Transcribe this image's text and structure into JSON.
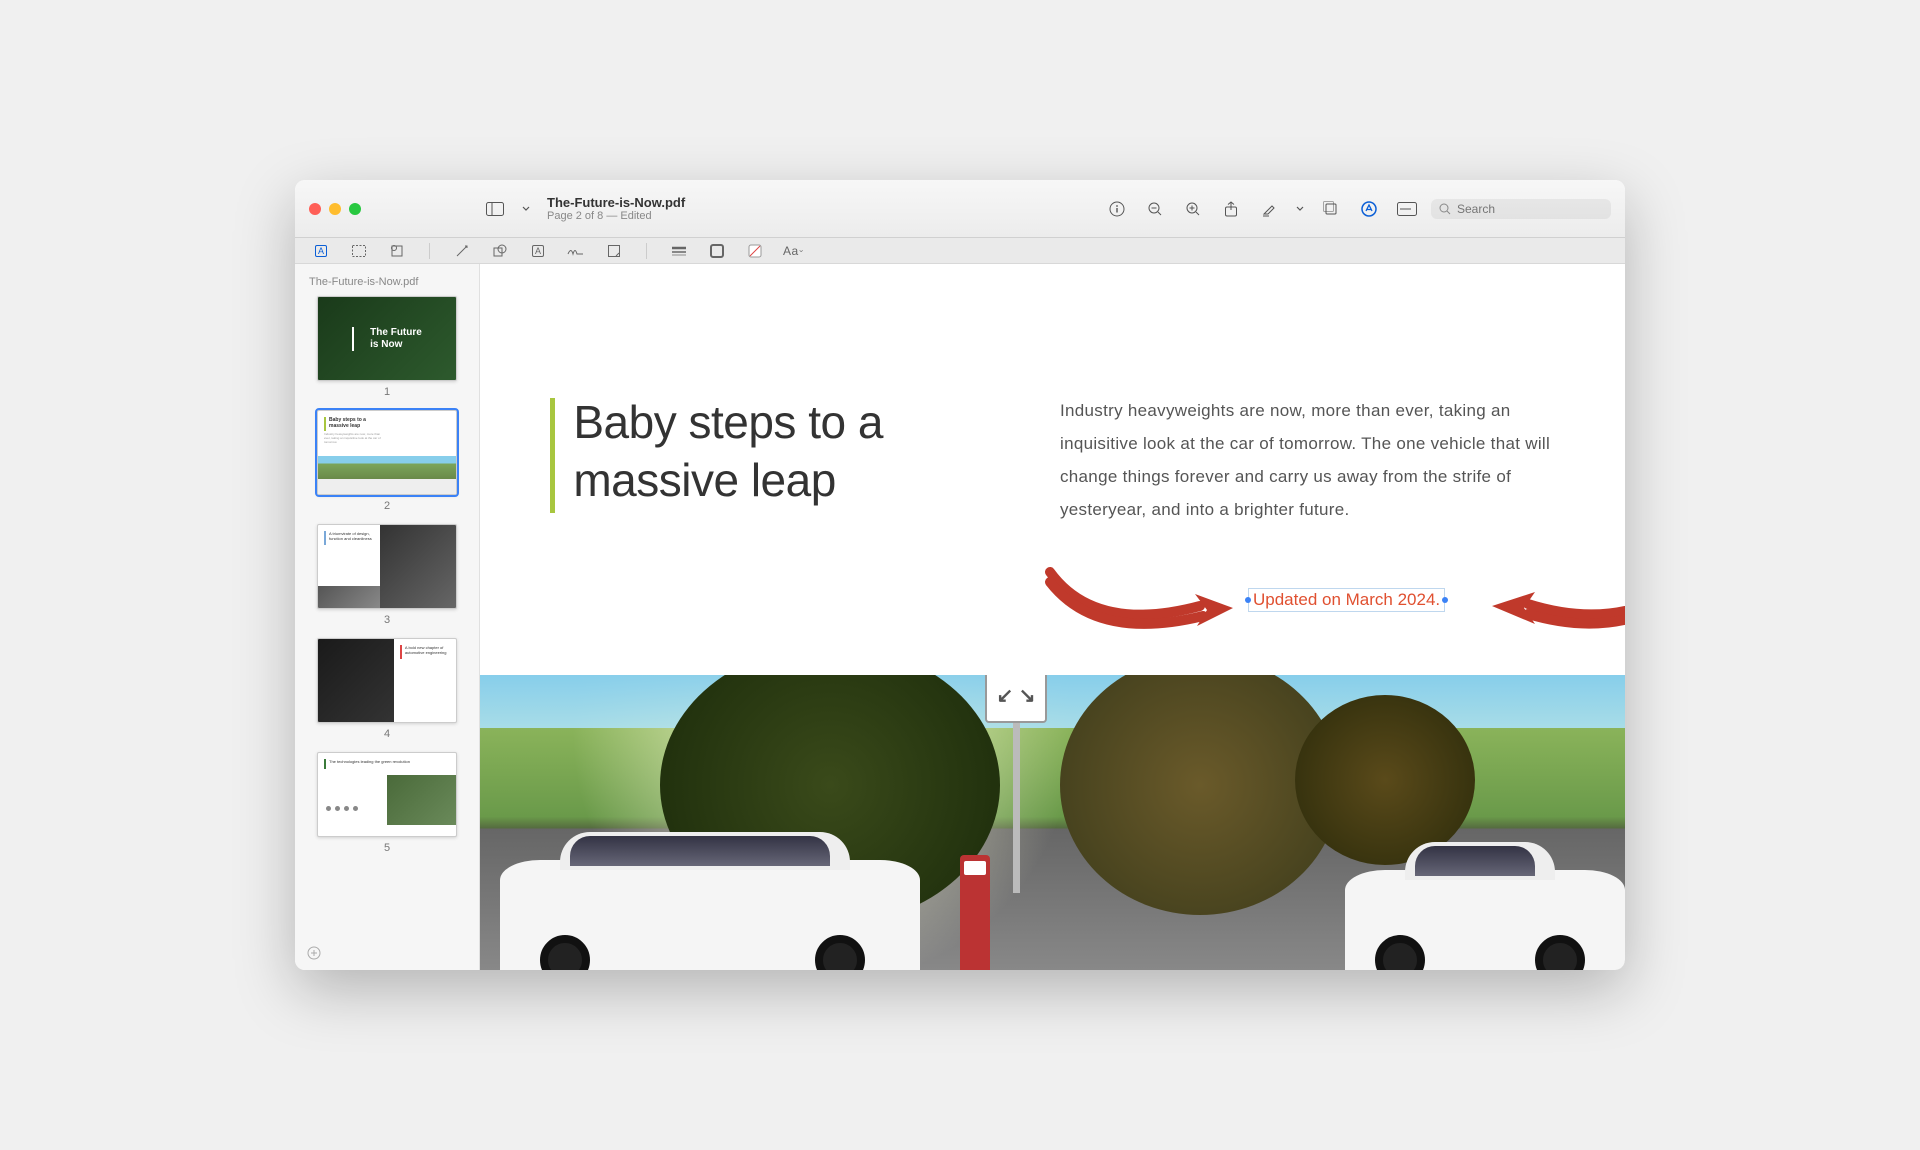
{
  "window": {
    "filename": "The-Future-is-Now.pdf",
    "subtitle": "Page 2 of 8 — Edited"
  },
  "sidebar": {
    "title": "The-Future-is-Now.pdf",
    "thumbs": [
      {
        "num": "1",
        "title_line1": "The Future",
        "title_line2": "is Now"
      },
      {
        "num": "2",
        "title": "Baby steps to a massive leap"
      },
      {
        "num": "3",
        "title": "A triumvirate of design, function and cleanliness"
      },
      {
        "num": "4",
        "title": "A bold new chapter of automotive engineering"
      },
      {
        "num": "5",
        "title": "The technologies leading the green revolution"
      }
    ]
  },
  "search": {
    "placeholder": "Search"
  },
  "toolbar2": {
    "aa": "Aa"
  },
  "document": {
    "heading": "Baby steps to a massive leap",
    "body": "Industry heavyweights are now, more than ever, taking an inquisitive look at the car of tomorrow. The one vehicle that will change things forever and carry us away from the strife of yesteryear, and into a brighter future.",
    "annotation": "Updated on March 2024.",
    "sign_arrows": "↙ ↘"
  },
  "colors": {
    "accent_green": "#a8c63f",
    "annotation_red": "#e05030",
    "arrow_red": "#c0392b"
  }
}
